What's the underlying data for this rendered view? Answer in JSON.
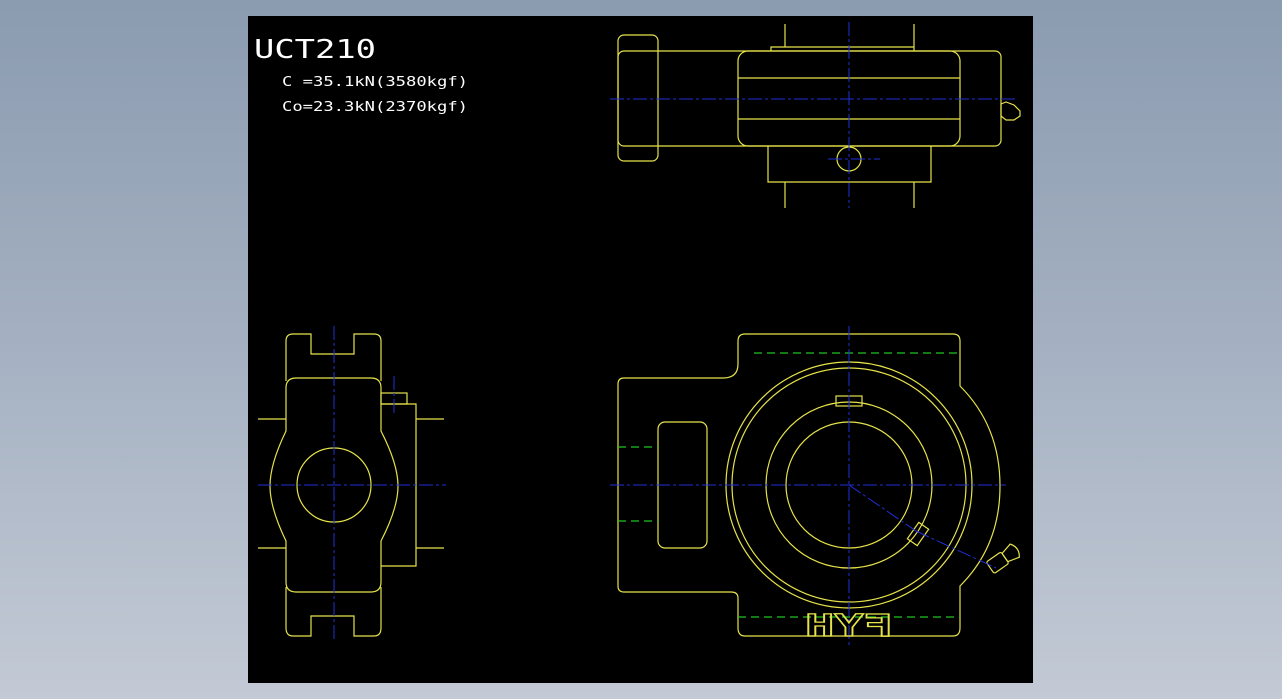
{
  "drawing": {
    "part_number": "UCT210",
    "load_ratings": [
      "C =35.1kN(3580kgf)",
      "Co=23.3kN(2370kgf)"
    ],
    "housing_marking": "FYH",
    "colors": {
      "background": "#000000",
      "outline": "#e6e34a",
      "centerline": "#1f2fd8",
      "hidden_line": "#21c221",
      "text": "#ffffff"
    }
  }
}
